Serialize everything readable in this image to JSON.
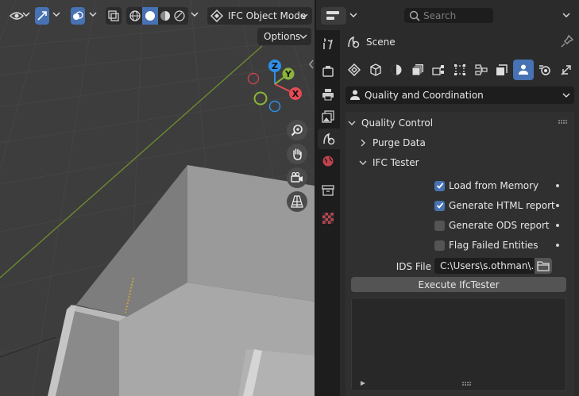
{
  "viewport": {
    "mode_label": "IFC Object Mode",
    "options_label": "Options",
    "gizmo": {
      "z": "Z",
      "y": "Y",
      "x": "X"
    }
  },
  "properties": {
    "search_placeholder": "Search",
    "context_label": "Scene",
    "dropdown_value": "Quality and Coordination",
    "panel": {
      "title": "Quality Control",
      "purge_label": "Purge Data",
      "tester_label": "IFC Tester",
      "checks": [
        {
          "label": "Load from Memory",
          "checked": true
        },
        {
          "label": "Generate HTML report",
          "checked": true
        },
        {
          "label": "Generate ODS report",
          "checked": false
        },
        {
          "label": "Flag Failed Entities",
          "checked": false
        }
      ],
      "ids_label": "IDS File",
      "ids_value": "C:\\Users\\s.othman\\...",
      "execute_label": "Execute IfcTester"
    }
  },
  "colors": {
    "accent": "#4772b3",
    "x_axis": "#e24b56",
    "y_axis": "#8bb53a",
    "z_axis": "#2e8fe8"
  }
}
